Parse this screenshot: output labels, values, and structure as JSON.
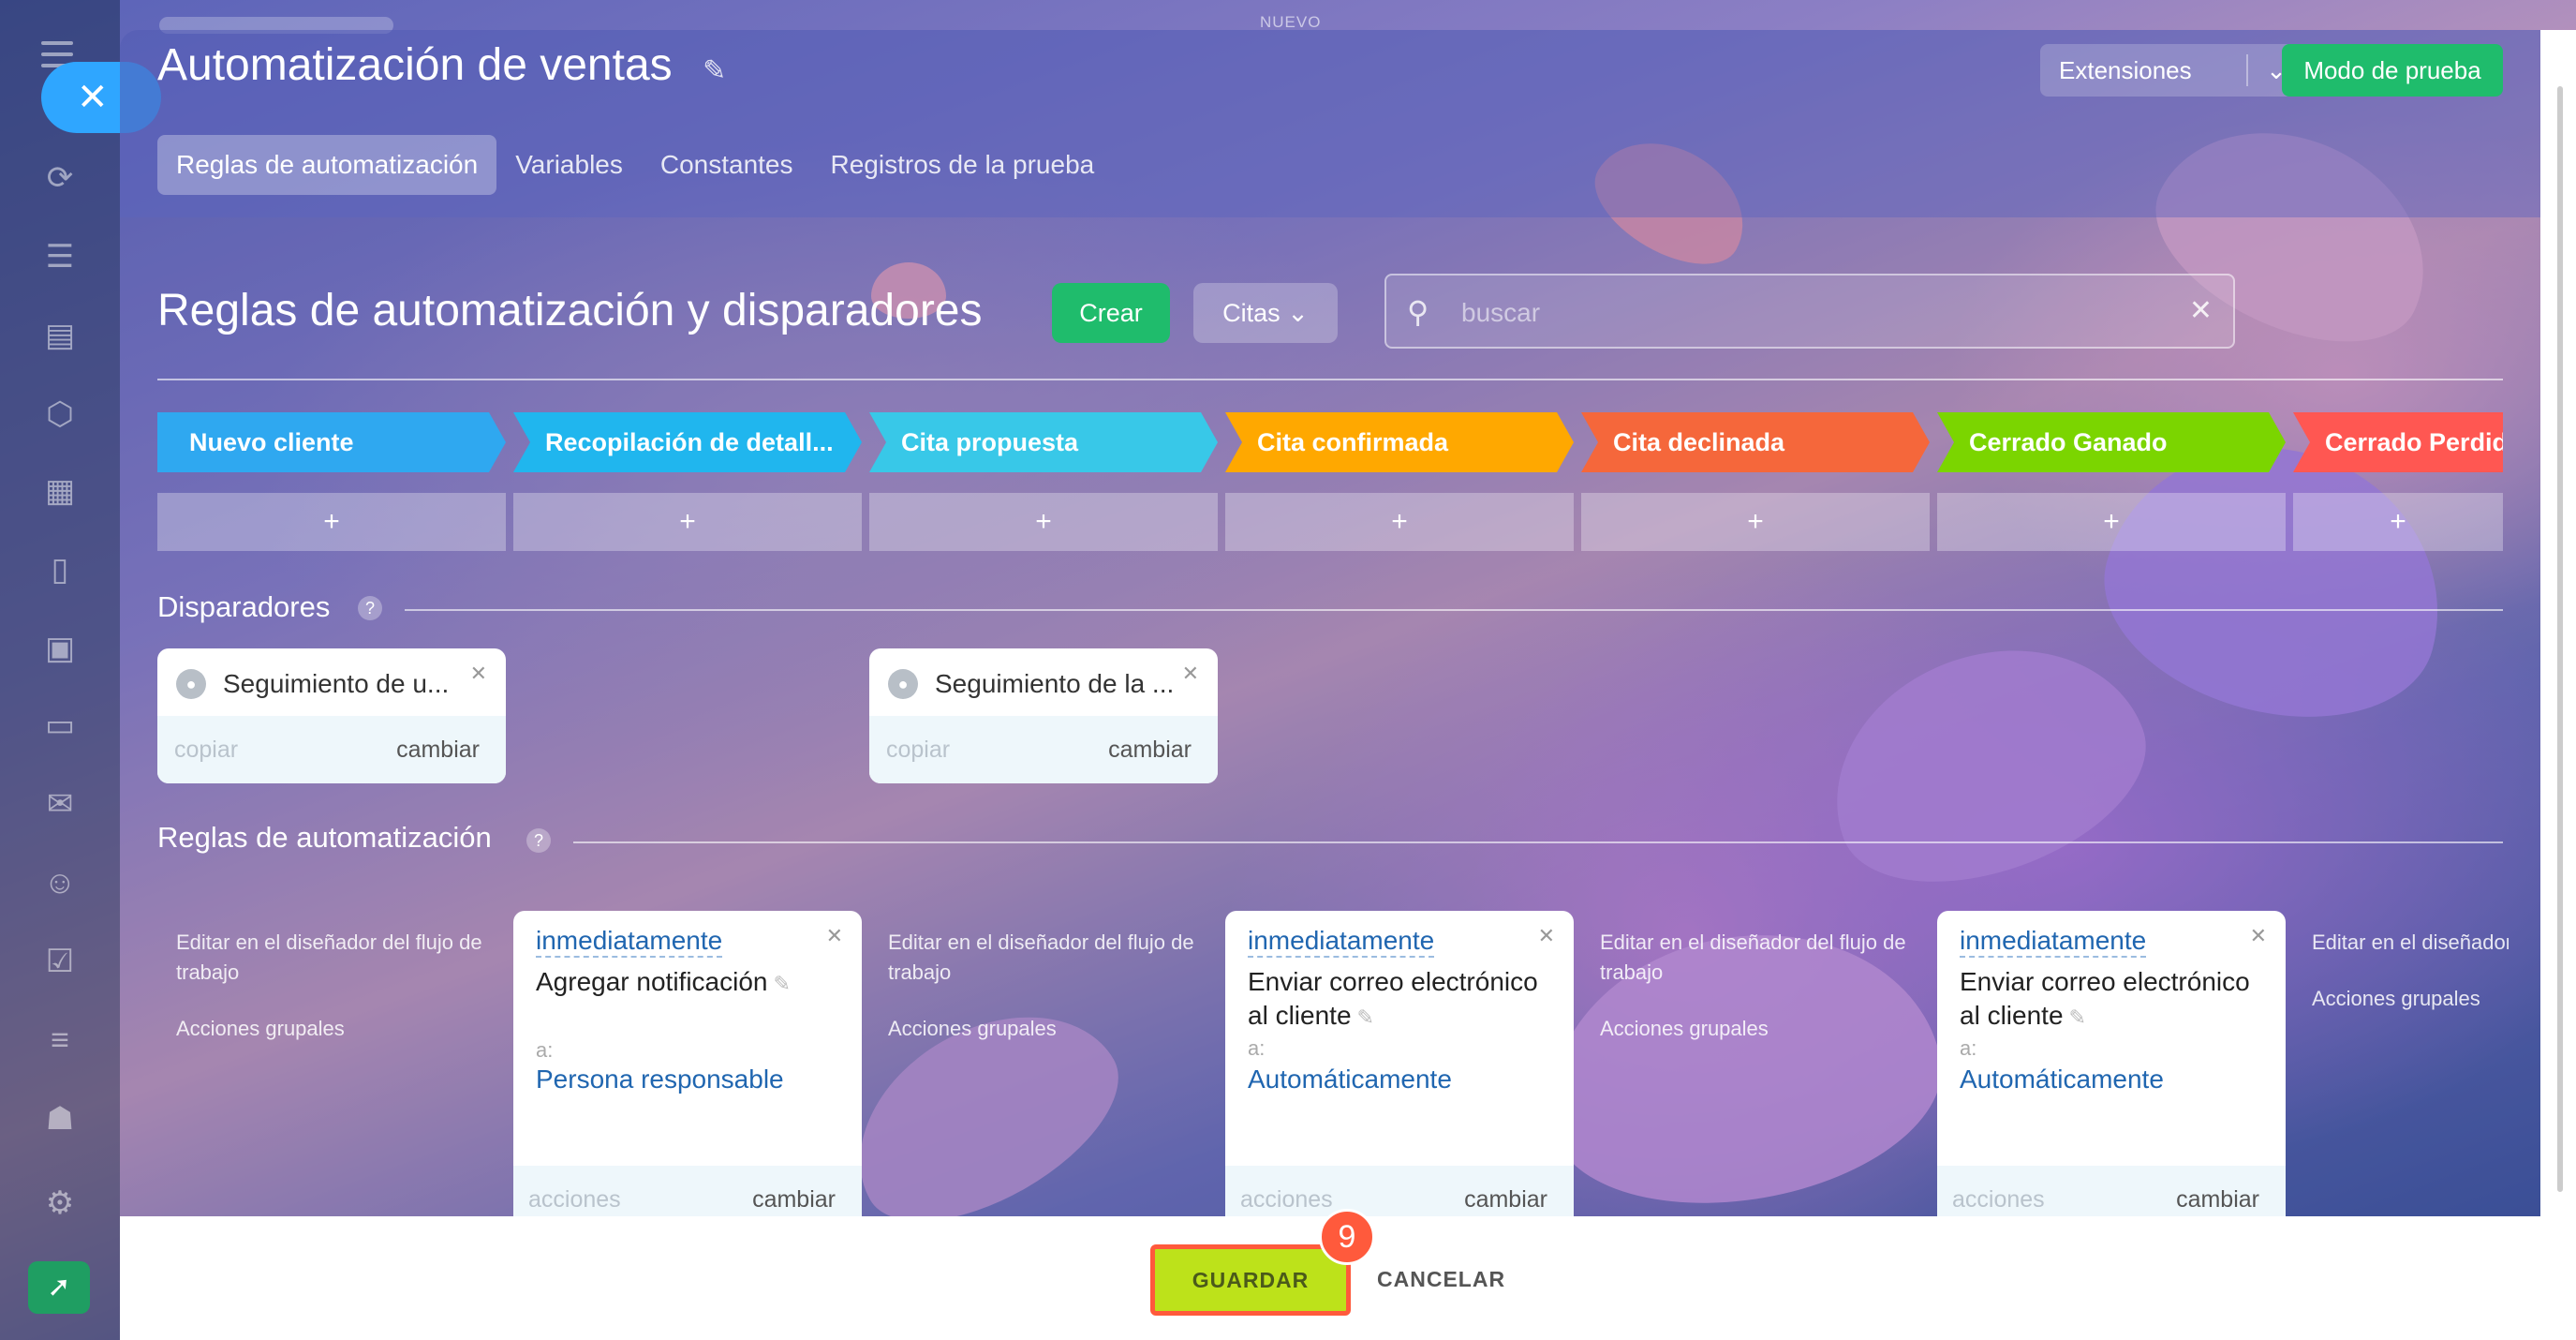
{
  "top_label": "NUEVO",
  "header": {
    "title": "Automatización de ventas",
    "extensions_label": "Extensiones",
    "test_mode_label": "Modo de prueba",
    "tabs": [
      {
        "label": "Reglas de automatización"
      },
      {
        "label": "Variables"
      },
      {
        "label": "Constantes"
      },
      {
        "label": "Registros de la prueba"
      }
    ]
  },
  "toolbar": {
    "section_title": "Reglas de automatización y disparadores",
    "create_label": "Crear",
    "filter_label": "Citas",
    "search_placeholder": "buscar"
  },
  "stages": [
    {
      "label": "Nuevo cliente",
      "color": "#2fa8f0"
    },
    {
      "label": "Recopilación de detall...",
      "color": "#20b6ee"
    },
    {
      "label": "Cita propuesta",
      "color": "#38c8e8"
    },
    {
      "label": "Cita confirmada",
      "color": "#ffa800"
    },
    {
      "label": "Cita declinada",
      "color": "#f5673b"
    },
    {
      "label": "Cerrado Ganado",
      "color": "#7bd500"
    },
    {
      "label": "Cerrado Perdido",
      "color": "#ff5752"
    }
  ],
  "add_label": "+",
  "triggers": {
    "title": "Disparadores",
    "copy_label": "copiar",
    "change_label": "cambiar",
    "items": [
      {
        "name": "Seguimiento de u..."
      },
      {
        "name": "Seguimiento de la ..."
      }
    ]
  },
  "rules": {
    "title": "Reglas de automatización",
    "designer_label": "Editar en el diseñador del flujo de trabajo",
    "group_label": "Acciones grupales",
    "to_label": "a:",
    "actions_label": "acciones",
    "change_label": "cambiar",
    "when_label": "inmediatamente",
    "cards": [
      {
        "action": "Agregar notificación",
        "target": "Persona responsable"
      },
      {
        "action": "Enviar correo electrónico al cliente",
        "target": "Automáticamente"
      },
      {
        "action": "Enviar correo electrónico al cliente",
        "target": "Automáticamente"
      }
    ]
  },
  "footer": {
    "save_label": "GUARDAR",
    "cancel_label": "CANCELAR",
    "step_badge": "9"
  }
}
